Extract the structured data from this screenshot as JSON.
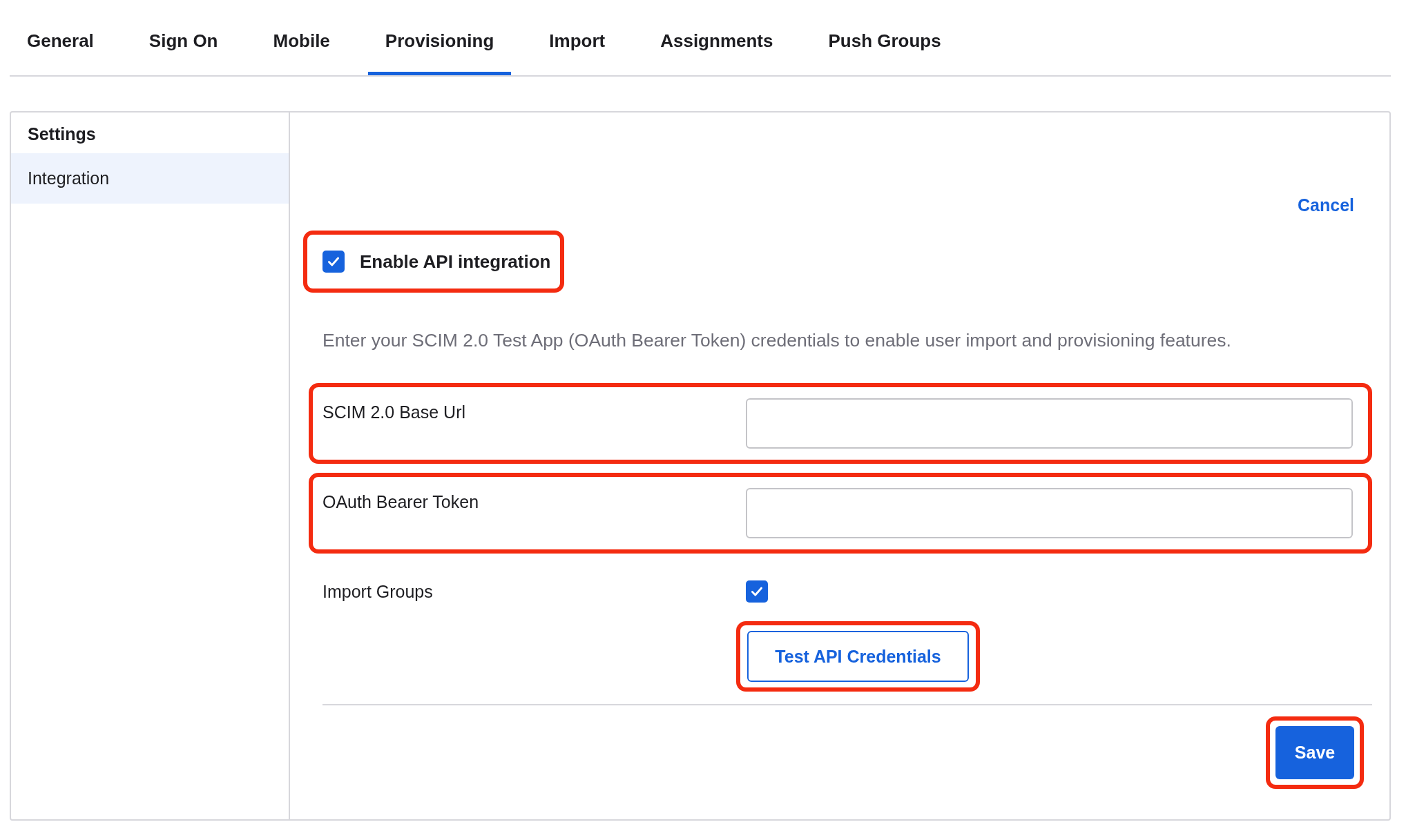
{
  "tabs": [
    {
      "label": "General",
      "selected": false
    },
    {
      "label": "Sign On",
      "selected": false
    },
    {
      "label": "Mobile",
      "selected": false
    },
    {
      "label": "Provisioning",
      "selected": true
    },
    {
      "label": "Import",
      "selected": false
    },
    {
      "label": "Assignments",
      "selected": false
    },
    {
      "label": "Push Groups",
      "selected": false
    }
  ],
  "sidebar": {
    "heading": "Settings",
    "items": [
      {
        "label": "Integration",
        "selected": true
      }
    ]
  },
  "cancel": "Cancel",
  "enable_api": {
    "label": "Enable API integration",
    "checked": true,
    "highlighted": true
  },
  "description": "Enter your SCIM 2.0 Test App (OAuth Bearer Token) credentials to enable user import and provisioning features.",
  "fields": [
    {
      "kind": "text",
      "label": "SCIM 2.0 Base Url",
      "highlighted": true
    },
    {
      "kind": "text",
      "label": "OAuth Bearer Token",
      "highlighted": true
    },
    {
      "kind": "checkbox",
      "label": "Import Groups",
      "checked": true,
      "highlighted": false
    }
  ],
  "test_button": {
    "label": "Test API Credentials",
    "highlighted": true
  },
  "save_button": {
    "label": "Save",
    "highlighted": true
  }
}
